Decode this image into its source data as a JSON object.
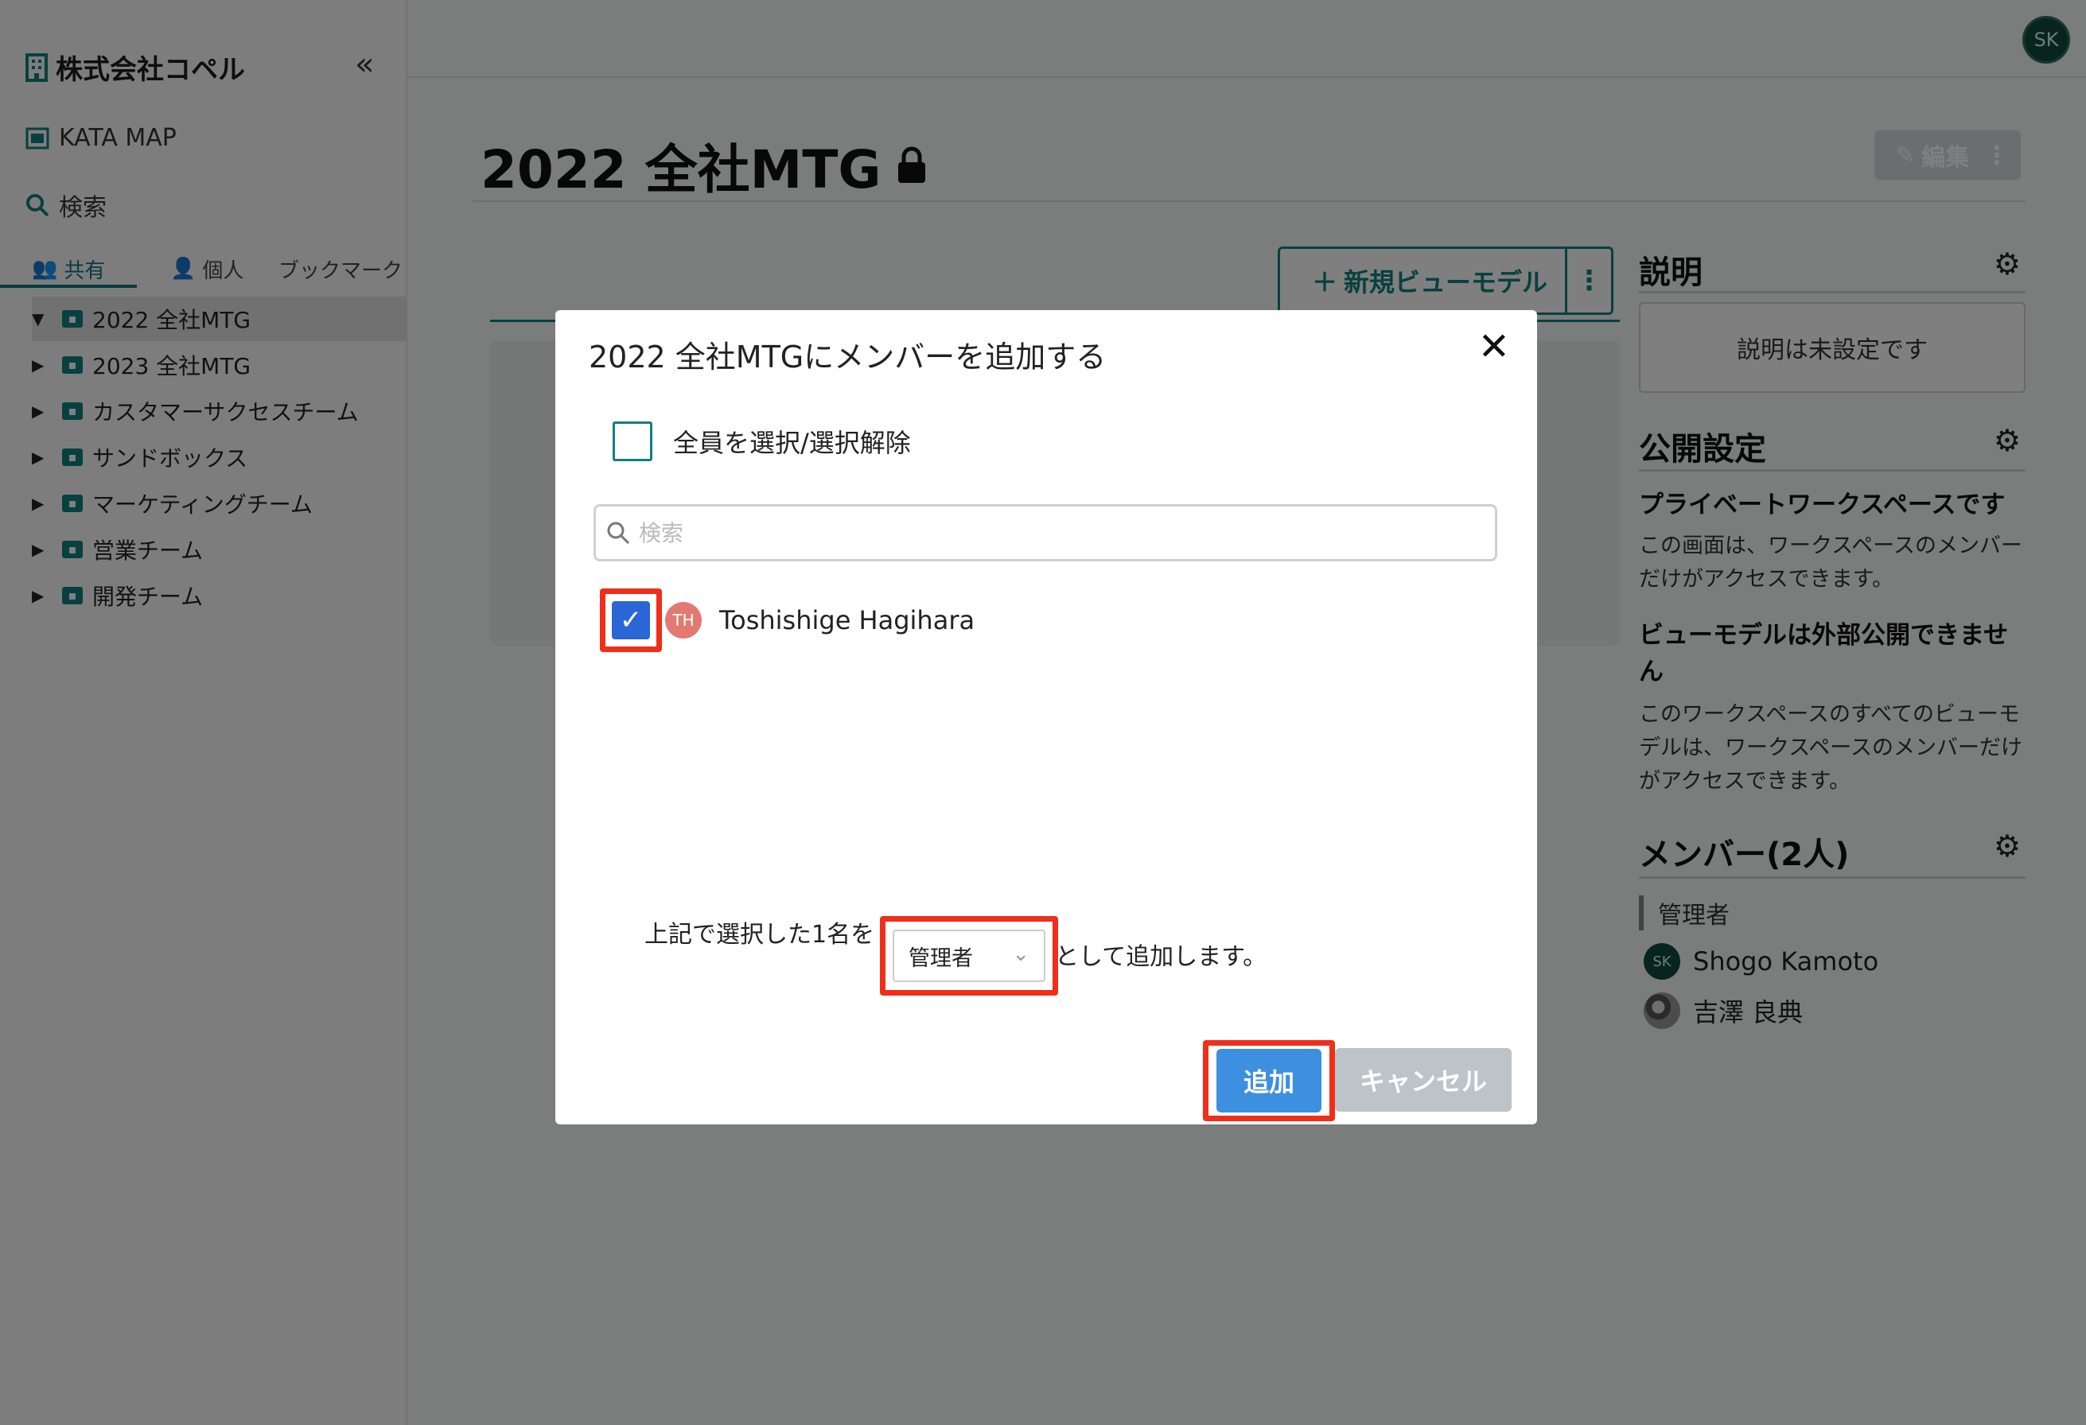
{
  "sidebar": {
    "company": "株式会社コペル",
    "collapse": "«",
    "kata_map": "KATA MAP",
    "search": "検索",
    "tabs": {
      "shared": "共有",
      "personal": "個人",
      "bookmark": "ブックマーク"
    },
    "tree": [
      "2022 全社MTG",
      "2023 全社MTG",
      "カスタマーサクセスチーム",
      "サンドボックス",
      "マーケティングチーム",
      "営業チーム",
      "開発チーム"
    ]
  },
  "header": {
    "user_initials": "SK"
  },
  "main": {
    "title": "2022 全社MTG",
    "edit_label": "編集",
    "new_viewmodel_label": "新規ビューモデル"
  },
  "right": {
    "desc_heading": "説明",
    "desc_empty": "説明は未設定です",
    "public_heading": "公開設定",
    "private_title": "プライベートワークスペースです",
    "private_text": "この画面は、ワークスペースのメンバーだけがアクセスできます。",
    "vm_title": "ビューモデルは外部公開できません",
    "vm_text": "このワークスペースのすべてのビューモデルは、ワークスペースのメンバーだけがアクセスできます。",
    "members_heading": "メンバー(2人)",
    "role_label": "管理者",
    "members": [
      {
        "initials": "SK",
        "name": "Shogo Kamoto"
      },
      {
        "initials": "",
        "name": "吉澤 良典"
      }
    ]
  },
  "modal": {
    "title": "2022 全社MTGにメンバーを追加する",
    "select_all": "全員を選択/選択解除",
    "search_placeholder": "検索",
    "user": {
      "initials": "TH",
      "name": "Toshishige Hagihara"
    },
    "role_prefix": "上記で選択した1名を",
    "role_value": "管理者",
    "role_suffix": "として追加します。",
    "add_label": "追加",
    "cancel_label": "キャンセル"
  }
}
